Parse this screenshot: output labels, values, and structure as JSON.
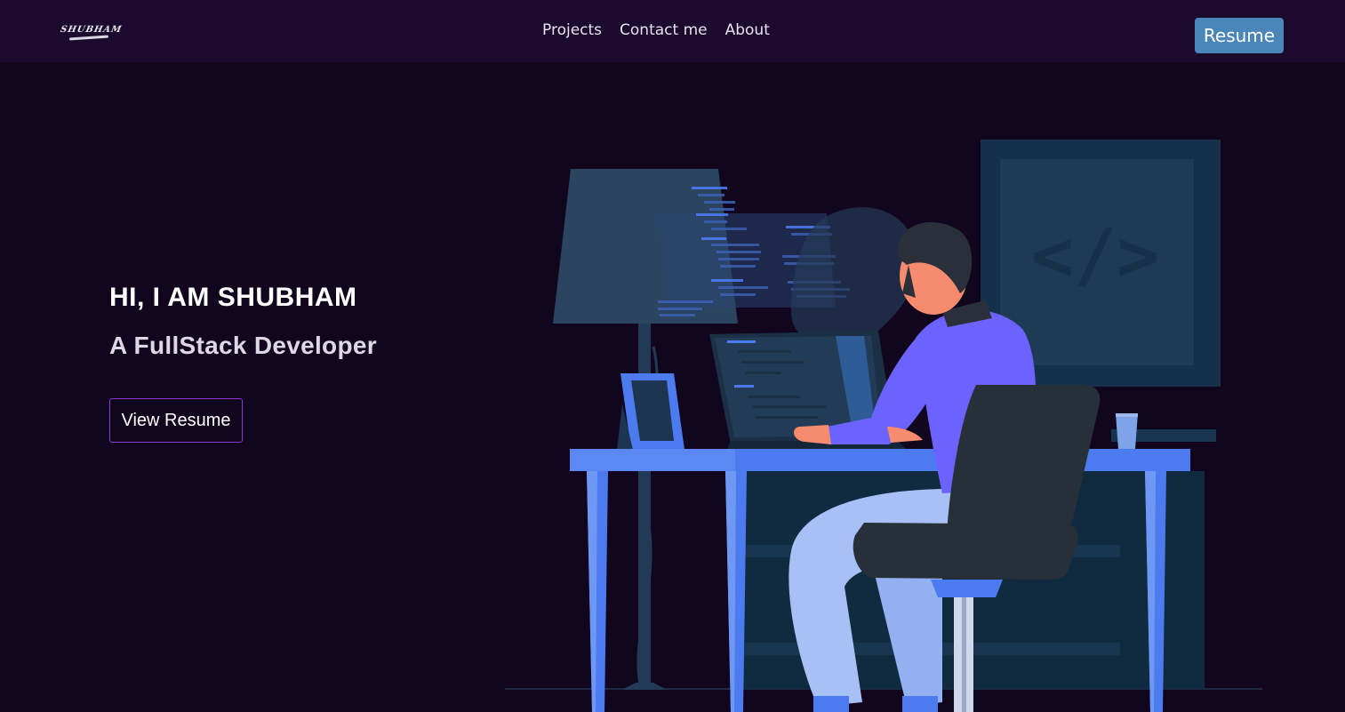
{
  "navbar": {
    "logo_text": "SHUBHAM",
    "links": [
      "Projects",
      "Contact me",
      "About"
    ],
    "resume_label": "Resume"
  },
  "hero": {
    "title": "HI, I AM SHUBHAM",
    "subtitle": "A FullStack Developer",
    "cta_label": "View Resume"
  },
  "illustration": {
    "description_icon": "developer-at-desk-illustration",
    "monitor_symbol": "</>"
  },
  "colors": {
    "page_bg": "#12061f",
    "navbar_bg": "#1b0a2e",
    "resume_button": "#4a86b8",
    "cta_border": "#8c35d6",
    "desk_blue": "#4c7bf0",
    "shirt_purple": "#6c63ff",
    "dark_navy": "#1d3550"
  }
}
